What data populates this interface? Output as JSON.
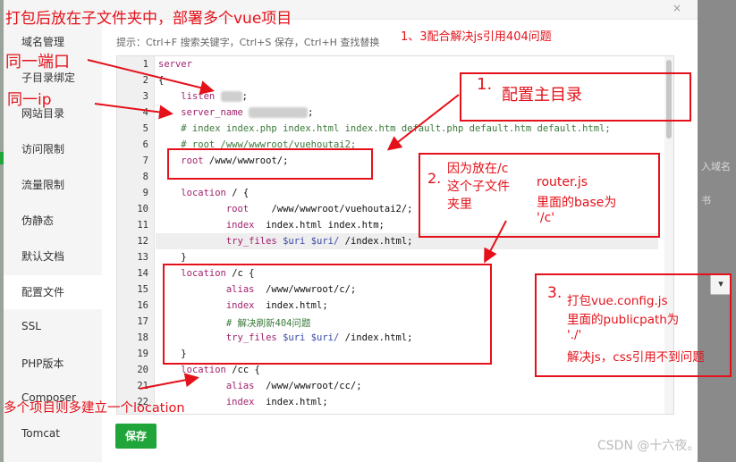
{
  "dialog": {
    "close_label": "×",
    "hint": "提示：Ctrl+F 搜索关键字，Ctrl+S 保存，Ctrl+H 查找替换",
    "save_label": "保存"
  },
  "sidebar": {
    "items": [
      {
        "label": "域名管理"
      },
      {
        "label": "子目录绑定"
      },
      {
        "label": "网站目录"
      },
      {
        "label": "访问限制"
      },
      {
        "label": "流量限制"
      },
      {
        "label": "伪静态"
      },
      {
        "label": "默认文档"
      },
      {
        "label": "配置文件",
        "active": true
      },
      {
        "label": "SSL"
      },
      {
        "label": "PHP版本"
      },
      {
        "label": "Composer"
      },
      {
        "label": "Tomcat"
      }
    ]
  },
  "editor": {
    "line_numbers": [
      "1",
      "2",
      "3",
      "4",
      "5",
      "6",
      "7",
      "8",
      "9",
      "10",
      "11",
      "12",
      "13",
      "14",
      "15",
      "16",
      "17",
      "18",
      "19",
      "20",
      "21",
      "22"
    ],
    "lines": [
      "server",
      "{",
      "    listen        ;",
      "    server_name        ;",
      "    # index index.php index.html index.htm default.php default.htm default.html;",
      "    # root /www/wwwroot/vuehoutai2;",
      "    root /www/wwwroot/;",
      "",
      "    location / {",
      "            root    /www/wwwroot/vuehoutai2/;",
      "            index  index.html index.htm;",
      "            try_files $uri $uri/ /index.html;",
      "    }",
      "    location /c {",
      "            alias  /www/wwwroot/c/;",
      "            index  index.html;",
      "            # 解决刷新404问题",
      "            try_files $uri $uri/ /index.html;",
      "    }",
      "    location /cc {",
      "            alias  /www/wwwroot/cc/;",
      "            index  index.html;"
    ],
    "highlighted_line": 12
  },
  "annotations": {
    "top_title": "打包后放在子文件夹中，部署多个vue项目",
    "same_port": "同一端口",
    "same_ip": "同一ip",
    "top_note": "1、3配合解决js引用404问题",
    "box1_num": "1.",
    "box1_text": "配置主目录",
    "box2_num": "2.",
    "box2_line1": "因为放在/c",
    "box2_line2": "这个子文件",
    "box2_line3": "夹里",
    "box2_right1": "router.js",
    "box2_right2": "里面的base为",
    "box2_right3": "'/c'",
    "box3_num": "3.",
    "box3_line1": "打包vue.config.js",
    "box3_line2": "里面的publicpath为",
    "box3_line3": "'./'",
    "box3_line4": "解决js，css引用不到问题",
    "bottom_note": "多个项目则多建立一个location",
    "color": "#e4111a"
  },
  "background": {
    "right_peek_1": "入域名",
    "right_peek_2": "书",
    "select_arrow": "▾"
  },
  "watermark": "CSDN @十六夜。",
  "colors": {
    "save_button": "#20a53a",
    "annotation_red": "#e4111a"
  }
}
